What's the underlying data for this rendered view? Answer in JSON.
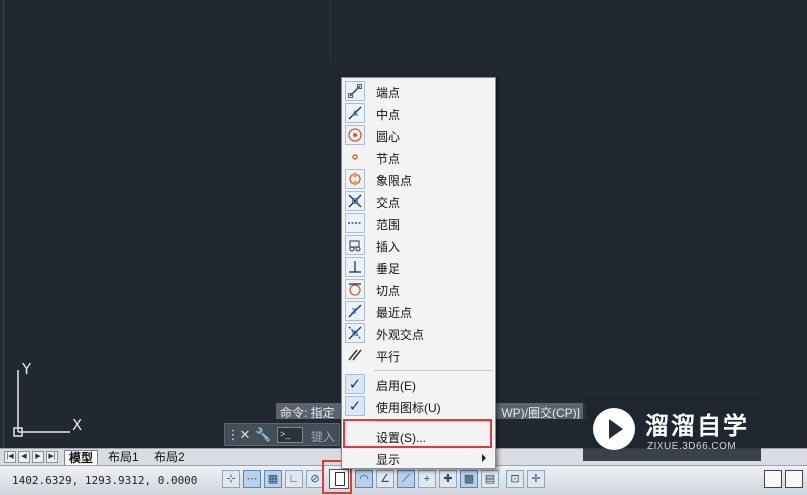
{
  "ucs": {
    "x_label": "X",
    "y_label": "Y"
  },
  "command": {
    "history_text": "命令: 指定",
    "history_tail": "WP)/圈交(CP)]",
    "prompt_icon": "terminal-icon",
    "input_placeholder": "键入命"
  },
  "layout_tabs": [
    "模型",
    "布局1",
    "布局2"
  ],
  "coordinates": "1402.6329, 1293.9312, 0.0000",
  "osnap_menu": {
    "items": [
      {
        "label": "端点",
        "icon": "endpoint-icon"
      },
      {
        "label": "中点",
        "icon": "midpoint-icon"
      },
      {
        "label": "圆心",
        "icon": "center-icon"
      },
      {
        "label": "节点",
        "icon": "node-icon"
      },
      {
        "label": "象限点",
        "icon": "quadrant-icon"
      },
      {
        "label": "交点",
        "icon": "intersection-icon"
      },
      {
        "label": "范围",
        "icon": "extension-icon"
      },
      {
        "label": "插入",
        "icon": "insert-icon"
      },
      {
        "label": "垂足",
        "icon": "perpendicular-icon"
      },
      {
        "label": "切点",
        "icon": "tangent-icon"
      },
      {
        "label": "最近点",
        "icon": "nearest-icon"
      },
      {
        "label": "外观交点",
        "icon": "apparent-intersection-icon"
      },
      {
        "label": "平行",
        "icon": "parallel-icon"
      }
    ],
    "enable_label": "启用(E)",
    "use_icons_label": "使用图标(U)",
    "settings_label": "设置(S)...",
    "display_label": "显示"
  },
  "watermark": {
    "title": "溜溜自学",
    "url": "ZIXUE.3D66.COM"
  },
  "highlight_color": "#e53935"
}
